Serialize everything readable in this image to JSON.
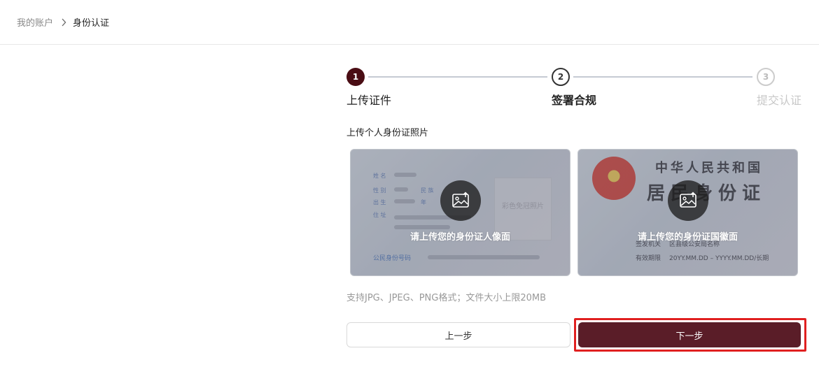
{
  "breadcrumb": {
    "parent": "我的账户",
    "current": "身份认证"
  },
  "steps": [
    {
      "number": "1",
      "label": "上传证件",
      "state": "active"
    },
    {
      "number": "2",
      "label": "签署合规",
      "state": "pending"
    },
    {
      "number": "3",
      "label": "提交认证",
      "state": "disabled"
    }
  ],
  "upload": {
    "title": "上传个人身份证照片",
    "front": {
      "prompt": "请上传您的身份证人像面",
      "sample_labels": [
        "姓 名",
        "性 别",
        "民 族",
        "出 生",
        "年",
        "住 址"
      ],
      "photo_text": "彩色免冠照片",
      "id_number_label": "公民身份号码"
    },
    "back": {
      "prompt": "请上传您的身份证国徽面",
      "title_line1": "中华人民共和国",
      "title_line2": "居民身份证",
      "authority_label": "签发机关",
      "authority_value": "区县级公安局名称",
      "validity_label": "有效期限",
      "validity_value": "20YY.MM.DD – YYYY.MM.DD/长期"
    },
    "hint": "支持JPG、JPEG、PNG格式；文件大小上限20MB"
  },
  "buttons": {
    "prev": "上一步",
    "next": "下一步"
  },
  "colors": {
    "accent": "#4a0d14",
    "next_button": "#5a1d28",
    "highlight": "#e02020"
  }
}
